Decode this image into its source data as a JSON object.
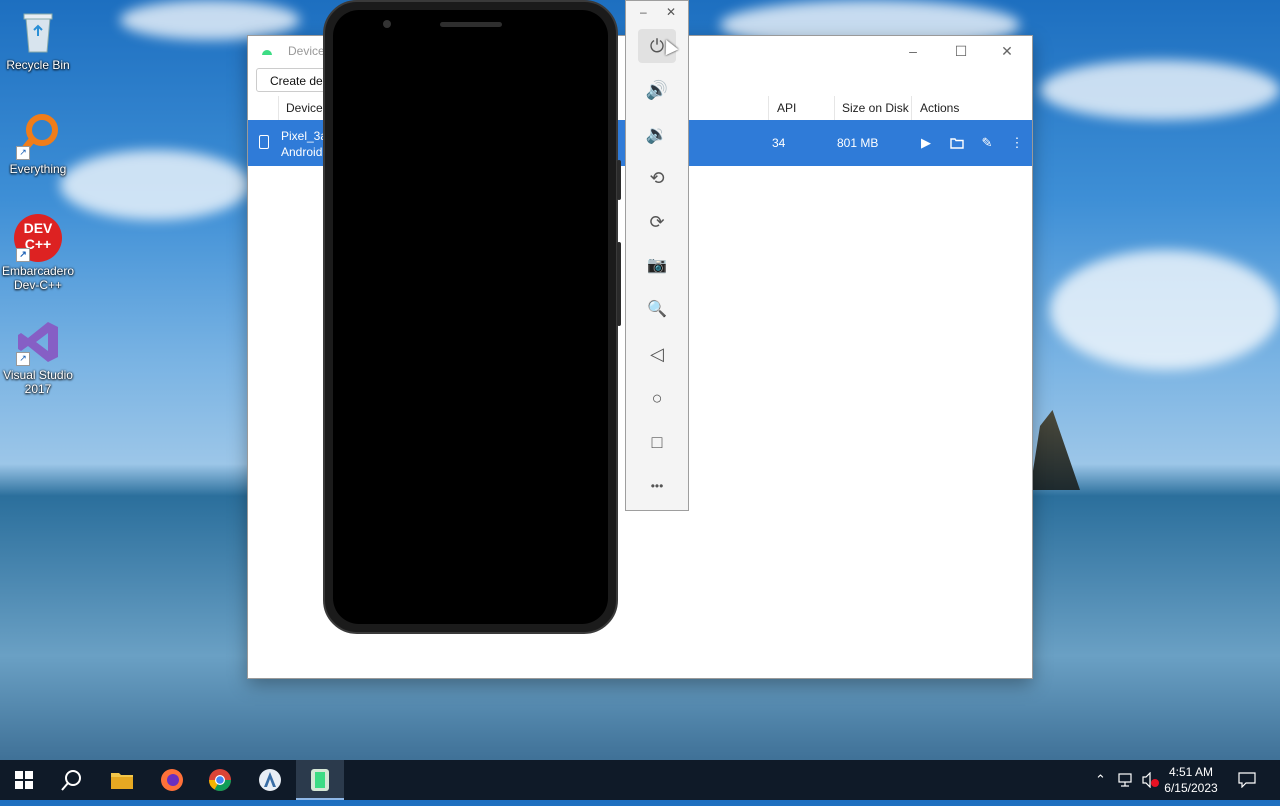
{
  "desktop": {
    "icons": [
      {
        "label": "Recycle Bin"
      },
      {
        "label": "Everything"
      },
      {
        "label": "Embarcadero Dev-C++",
        "logo_text": "DEV C++"
      },
      {
        "label": "Visual Studio 2017"
      }
    ]
  },
  "device_manager": {
    "title": "Device",
    "create_button": "Create dev",
    "columns": {
      "device": "Device",
      "api": "API",
      "size": "Size on Disk",
      "actions": "Actions"
    },
    "rows": [
      {
        "name": "Pixel_3a",
        "subtitle": "Android",
        "api": "34",
        "size": "801 MB",
        "selected": true
      }
    ],
    "window_controls": {
      "minimize": "–",
      "maximize": "☐",
      "close": "✕"
    }
  },
  "emulator_toolbar": {
    "controls": {
      "minimize": "–",
      "close": "✕"
    },
    "buttons": [
      {
        "name": "power",
        "icon": "⏻"
      },
      {
        "name": "volume-up",
        "icon": "🔊"
      },
      {
        "name": "volume-down",
        "icon": "🔉"
      },
      {
        "name": "rotate-left",
        "icon": "⟲"
      },
      {
        "name": "rotate-right",
        "icon": "⟳"
      },
      {
        "name": "screenshot",
        "icon": "📷"
      },
      {
        "name": "zoom",
        "icon": "🔍"
      },
      {
        "name": "back",
        "icon": "◁"
      },
      {
        "name": "home",
        "icon": "○"
      },
      {
        "name": "overview",
        "icon": "□"
      },
      {
        "name": "more",
        "icon": "•••"
      }
    ]
  },
  "taskbar": {
    "clock": {
      "time": "4:51 AM",
      "date": "6/15/2023"
    }
  },
  "colors": {
    "selected_row": "#2f7bd8",
    "taskbar": "#0f1a28"
  }
}
